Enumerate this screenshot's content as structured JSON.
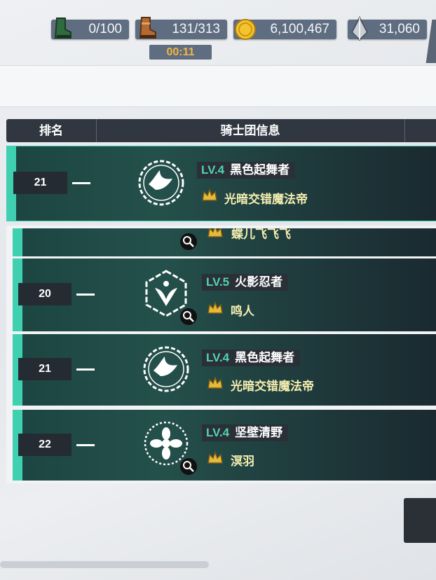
{
  "resources": [
    {
      "icon": "green-boot-icon",
      "value": "0/100"
    },
    {
      "icon": "brown-boot-icon",
      "value": "131/313"
    },
    {
      "icon": "gold-coin-icon",
      "value": "6,100,467"
    },
    {
      "icon": "silver-crystal-icon",
      "value": "31,060"
    }
  ],
  "timer": "00:11",
  "header": {
    "rank": "排名",
    "info": "骑士团信息"
  },
  "my_entry": {
    "rank": "21",
    "level": "LV.4",
    "guild": "黑色起舞者",
    "leader": "光暗交错魔法帝",
    "emblem": "dove-emblem-icon"
  },
  "partial_row": {
    "leader": "蝶儿飞飞飞"
  },
  "rows": [
    {
      "rank": "20",
      "level": "LV.5",
      "guild": "火影忍者",
      "leader": "鸣人",
      "emblem": "wing-emblem-icon"
    },
    {
      "rank": "21",
      "level": "LV.4",
      "guild": "黑色起舞者",
      "leader": "光暗交错魔法帝",
      "emblem": "dove-emblem-icon"
    },
    {
      "rank": "22",
      "level": "LV.4",
      "guild": "坚壁清野",
      "leader": "溟羽",
      "emblem": "flower-emblem-icon"
    }
  ],
  "colors": {
    "accent": "#3ed0b0",
    "level_text": "#4fd4b2",
    "leader_text": "#f6efb0",
    "timer_text": "#f2b543"
  }
}
